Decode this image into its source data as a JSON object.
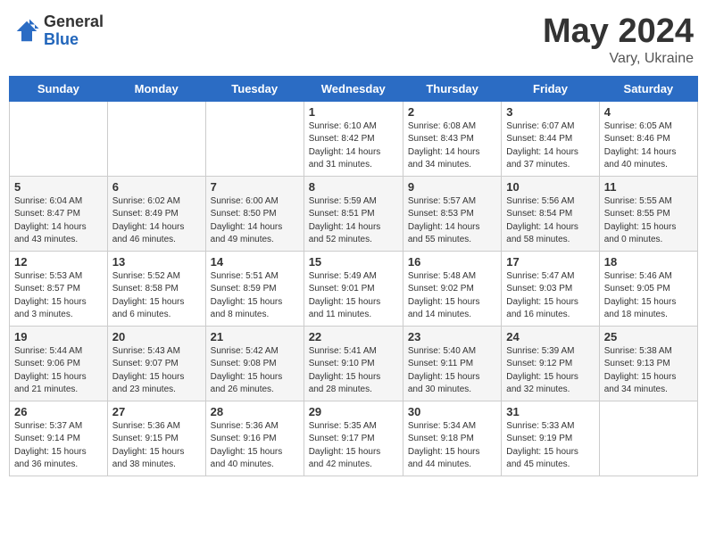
{
  "header": {
    "logo_general": "General",
    "logo_blue": "Blue",
    "month": "May 2024",
    "location": "Vary, Ukraine"
  },
  "weekdays": [
    "Sunday",
    "Monday",
    "Tuesday",
    "Wednesday",
    "Thursday",
    "Friday",
    "Saturday"
  ],
  "weeks": [
    [
      {
        "day": "",
        "info": ""
      },
      {
        "day": "",
        "info": ""
      },
      {
        "day": "",
        "info": ""
      },
      {
        "day": "1",
        "info": "Sunrise: 6:10 AM\nSunset: 8:42 PM\nDaylight: 14 hours\nand 31 minutes."
      },
      {
        "day": "2",
        "info": "Sunrise: 6:08 AM\nSunset: 8:43 PM\nDaylight: 14 hours\nand 34 minutes."
      },
      {
        "day": "3",
        "info": "Sunrise: 6:07 AM\nSunset: 8:44 PM\nDaylight: 14 hours\nand 37 minutes."
      },
      {
        "day": "4",
        "info": "Sunrise: 6:05 AM\nSunset: 8:46 PM\nDaylight: 14 hours\nand 40 minutes."
      }
    ],
    [
      {
        "day": "5",
        "info": "Sunrise: 6:04 AM\nSunset: 8:47 PM\nDaylight: 14 hours\nand 43 minutes."
      },
      {
        "day": "6",
        "info": "Sunrise: 6:02 AM\nSunset: 8:49 PM\nDaylight: 14 hours\nand 46 minutes."
      },
      {
        "day": "7",
        "info": "Sunrise: 6:00 AM\nSunset: 8:50 PM\nDaylight: 14 hours\nand 49 minutes."
      },
      {
        "day": "8",
        "info": "Sunrise: 5:59 AM\nSunset: 8:51 PM\nDaylight: 14 hours\nand 52 minutes."
      },
      {
        "day": "9",
        "info": "Sunrise: 5:57 AM\nSunset: 8:53 PM\nDaylight: 14 hours\nand 55 minutes."
      },
      {
        "day": "10",
        "info": "Sunrise: 5:56 AM\nSunset: 8:54 PM\nDaylight: 14 hours\nand 58 minutes."
      },
      {
        "day": "11",
        "info": "Sunrise: 5:55 AM\nSunset: 8:55 PM\nDaylight: 15 hours\nand 0 minutes."
      }
    ],
    [
      {
        "day": "12",
        "info": "Sunrise: 5:53 AM\nSunset: 8:57 PM\nDaylight: 15 hours\nand 3 minutes."
      },
      {
        "day": "13",
        "info": "Sunrise: 5:52 AM\nSunset: 8:58 PM\nDaylight: 15 hours\nand 6 minutes."
      },
      {
        "day": "14",
        "info": "Sunrise: 5:51 AM\nSunset: 8:59 PM\nDaylight: 15 hours\nand 8 minutes."
      },
      {
        "day": "15",
        "info": "Sunrise: 5:49 AM\nSunset: 9:01 PM\nDaylight: 15 hours\nand 11 minutes."
      },
      {
        "day": "16",
        "info": "Sunrise: 5:48 AM\nSunset: 9:02 PM\nDaylight: 15 hours\nand 14 minutes."
      },
      {
        "day": "17",
        "info": "Sunrise: 5:47 AM\nSunset: 9:03 PM\nDaylight: 15 hours\nand 16 minutes."
      },
      {
        "day": "18",
        "info": "Sunrise: 5:46 AM\nSunset: 9:05 PM\nDaylight: 15 hours\nand 18 minutes."
      }
    ],
    [
      {
        "day": "19",
        "info": "Sunrise: 5:44 AM\nSunset: 9:06 PM\nDaylight: 15 hours\nand 21 minutes."
      },
      {
        "day": "20",
        "info": "Sunrise: 5:43 AM\nSunset: 9:07 PM\nDaylight: 15 hours\nand 23 minutes."
      },
      {
        "day": "21",
        "info": "Sunrise: 5:42 AM\nSunset: 9:08 PM\nDaylight: 15 hours\nand 26 minutes."
      },
      {
        "day": "22",
        "info": "Sunrise: 5:41 AM\nSunset: 9:10 PM\nDaylight: 15 hours\nand 28 minutes."
      },
      {
        "day": "23",
        "info": "Sunrise: 5:40 AM\nSunset: 9:11 PM\nDaylight: 15 hours\nand 30 minutes."
      },
      {
        "day": "24",
        "info": "Sunrise: 5:39 AM\nSunset: 9:12 PM\nDaylight: 15 hours\nand 32 minutes."
      },
      {
        "day": "25",
        "info": "Sunrise: 5:38 AM\nSunset: 9:13 PM\nDaylight: 15 hours\nand 34 minutes."
      }
    ],
    [
      {
        "day": "26",
        "info": "Sunrise: 5:37 AM\nSunset: 9:14 PM\nDaylight: 15 hours\nand 36 minutes."
      },
      {
        "day": "27",
        "info": "Sunrise: 5:36 AM\nSunset: 9:15 PM\nDaylight: 15 hours\nand 38 minutes."
      },
      {
        "day": "28",
        "info": "Sunrise: 5:36 AM\nSunset: 9:16 PM\nDaylight: 15 hours\nand 40 minutes."
      },
      {
        "day": "29",
        "info": "Sunrise: 5:35 AM\nSunset: 9:17 PM\nDaylight: 15 hours\nand 42 minutes."
      },
      {
        "day": "30",
        "info": "Sunrise: 5:34 AM\nSunset: 9:18 PM\nDaylight: 15 hours\nand 44 minutes."
      },
      {
        "day": "31",
        "info": "Sunrise: 5:33 AM\nSunset: 9:19 PM\nDaylight: 15 hours\nand 45 minutes."
      },
      {
        "day": "",
        "info": ""
      }
    ]
  ]
}
